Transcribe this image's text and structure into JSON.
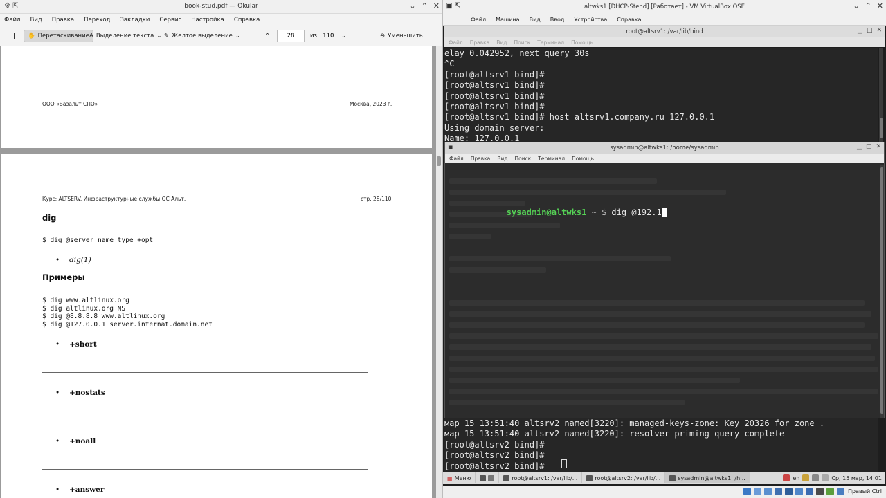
{
  "okular": {
    "title": "book-stud.pdf — Okular",
    "menu": [
      "Файл",
      "Вид",
      "Правка",
      "Переход",
      "Закладки",
      "Сервис",
      "Настройка",
      "Справка"
    ],
    "toolbar": {
      "drag": "Перетаскивание",
      "text_select": "Выделение текста",
      "yellow": "Желтое выделение",
      "page": "28",
      "of": "из",
      "total": "110",
      "zoom_out": "Уменьшить"
    },
    "page1": {
      "left_footer": "ООО «Базальт СПО»",
      "right_footer": "Москва, 2023 г."
    },
    "page2": {
      "header_left": "Курс: ALTSERV. Инфраструктурные службы ОС Альт.",
      "header_right": "стр. 28/110",
      "heading1": "dig",
      "syntax": "$ dig @server name type +opt",
      "ref": "dig(1)",
      "heading2": "Примеры",
      "examples": "$ dig www.altlinux.org\n$ dig altlinux.org NS\n$ dig @8.8.8.8 www.altlinux.org\n$ dig @127.0.0.1 server.internat.domain.net",
      "opt1": "+short",
      "opt2": "+nostats",
      "opt3": "+noall",
      "opt4": "+answer"
    }
  },
  "vbox": {
    "title": "altwks1 [DHCP-Stend] [Работает] - VM VirtualBox OSE",
    "menu": [
      "Файл",
      "Машина",
      "Вид",
      "Ввод",
      "Устройства",
      "Справка"
    ],
    "term1": {
      "title": "root@altsrv1: /var/lib/bind",
      "menu": [
        "Файл",
        "Правка",
        "Вид",
        "Поиск",
        "Терминал",
        "Помощь"
      ],
      "lines": "elay 0.042952, next query 30s\n^C\n[root@altsrv1 bind]#\n[root@altsrv1 bind]#\n[root@altsrv1 bind]#\n[root@altsrv1 bind]#\n[root@altsrv1 bind]# host altsrv1.company.ru 127.0.0.1\nUsing domain server:\nName: 127.0.0.1"
    },
    "term2": {
      "title": "sysadmin@altwks1: /home/sysadmin",
      "menu": [
        "Файл",
        "Правка",
        "Вид",
        "Поиск",
        "Терминал",
        "Помощь"
      ],
      "prompt_user": "sysadmin@altwks1",
      "prompt_sym": " ~ $ ",
      "command": "dig @192.1"
    },
    "term3": {
      "lines": "мар 15 13:51:40 altsrv2 named[3220]: managed-keys-zone: Key 20326 for zone .\nмар 15 13:51:40 altsrv2 named[3220]: resolver priming query complete\n[root@altsrv2 bind]#\n[root@altsrv2 bind]#\n[root@altsrv2 bind]# "
    },
    "taskbar": {
      "start": "Меню",
      "items": [
        "root@altsrv1: /var/lib/...",
        "root@altsrv2: /var/lib/...",
        "sysadmin@altwks1: /h..."
      ],
      "lang": "en",
      "clock": "Ср, 15 мар, 14:01"
    },
    "host_key": "Правый Ctrl"
  },
  "colors": {
    "prompt_green": "#55d155",
    "terminal_bg": "#262626"
  }
}
